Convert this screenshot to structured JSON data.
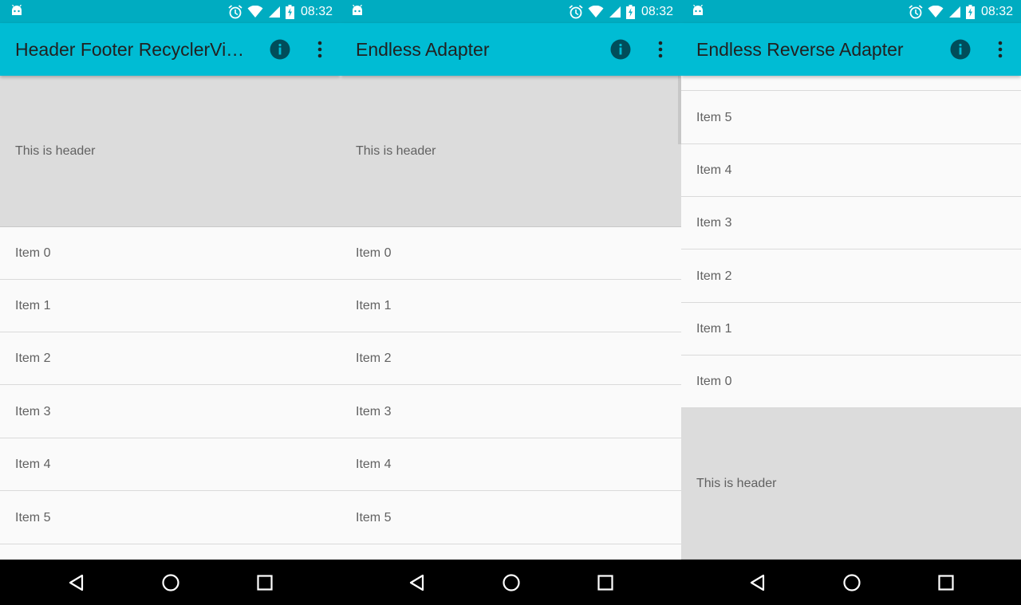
{
  "status": {
    "time": "08:32"
  },
  "screens": [
    {
      "title": "Header Footer RecyclerVi…",
      "header_text": "This is header",
      "items": [
        "Item 0",
        "Item 1",
        "Item 2",
        "Item 3",
        "Item 4",
        "Item 5"
      ]
    },
    {
      "title": "Endless Adapter",
      "header_text": "This is header",
      "items": [
        "Item 0",
        "Item 1",
        "Item 2",
        "Item 3",
        "Item 4",
        "Item 5"
      ]
    },
    {
      "title": "Endless Reverse Adapter",
      "header_text": "This is header",
      "items": [
        "Item 5",
        "Item 4",
        "Item 3",
        "Item 2",
        "Item 1",
        "Item 0"
      ]
    }
  ],
  "colors": {
    "status_bar": "#00acc1",
    "app_bar": "#00bcd4",
    "header_bg": "#dcdcdc",
    "list_bg": "#fafafa",
    "nav_bar": "#000000"
  },
  "icons": {
    "status": [
      "android-icon",
      "alarm-icon",
      "wifi-icon",
      "signal-icon",
      "battery-icon"
    ],
    "app_bar": [
      "info-icon",
      "overflow-menu-icon"
    ],
    "nav": [
      "back-icon",
      "home-icon",
      "recents-icon"
    ]
  }
}
